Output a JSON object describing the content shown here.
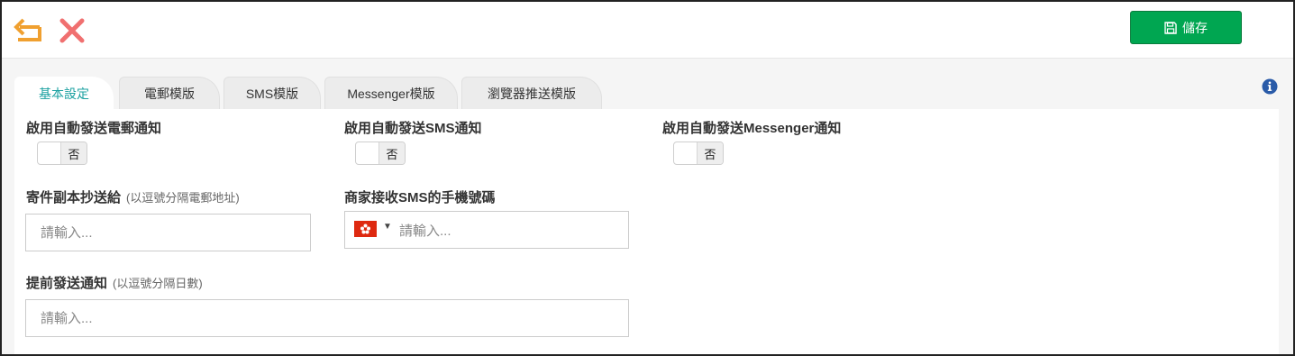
{
  "toolbar": {
    "undo_icon": "undo-arrow-icon",
    "close_icon": "close-x-icon",
    "save_label": "儲存",
    "save_icon": "floppy-disk-icon",
    "accent_orange": "#f0a030",
    "accent_red": "#f07070",
    "save_color": "#00a651"
  },
  "tabs": [
    {
      "label": "基本設定",
      "active": true
    },
    {
      "label": "電郵模版",
      "active": false
    },
    {
      "label": "SMS模版",
      "active": false
    },
    {
      "label": "Messenger模版",
      "active": false
    },
    {
      "label": "瀏覽器推送模版",
      "active": false
    }
  ],
  "info_icon": "info-circle-icon",
  "form": {
    "email_notify": {
      "label": "啟用自動發送電郵通知",
      "toggle_text": "否"
    },
    "sms_notify": {
      "label": "啟用自動發送SMS通知",
      "toggle_text": "否"
    },
    "messenger_notify": {
      "label": "啟用自動發送Messenger通知",
      "toggle_text": "否"
    },
    "cc_email": {
      "label": "寄件副本抄送給",
      "hint": "(以逗號分隔電郵地址)",
      "placeholder": "請輸入..."
    },
    "merchant_sms": {
      "label": "商家接收SMS的手機號碼",
      "placeholder": "請輸入...",
      "country_flag": "hong-kong-flag-icon"
    },
    "advance_notice": {
      "label": "提前發送通知",
      "hint": "(以逗號分隔日數)",
      "placeholder": "請輸入..."
    }
  }
}
